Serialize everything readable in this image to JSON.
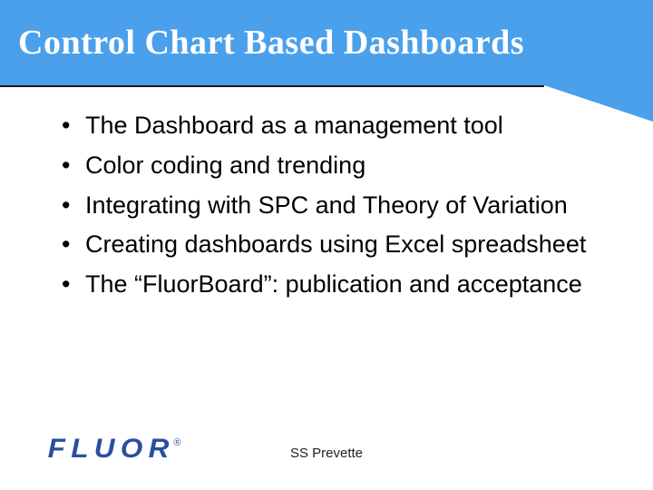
{
  "title": "Control Chart Based Dashboards",
  "bullets": [
    "The Dashboard as a management tool",
    "Color coding and trending",
    "Integrating with SPC and Theory of Variation",
    "Creating dashboards using Excel spreadsheet",
    "The “FluorBoard”: publication and acceptance"
  ],
  "logo": {
    "text": "FLUOR",
    "registered": "®"
  },
  "author": "SS Prevette"
}
